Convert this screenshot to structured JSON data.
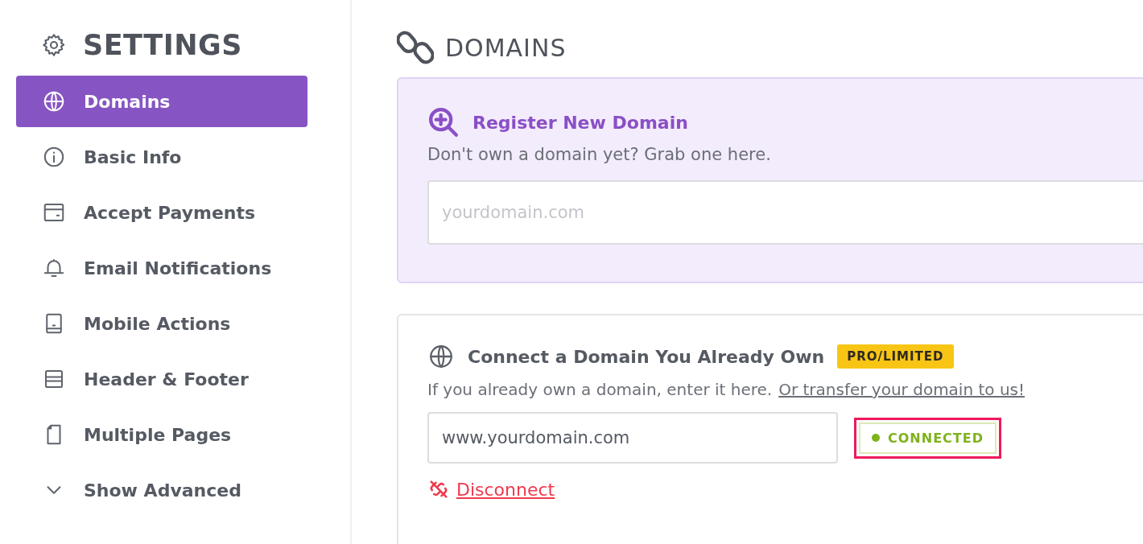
{
  "sidebar": {
    "title": "SETTINGS",
    "items": [
      {
        "label": "Domains",
        "selected": true
      },
      {
        "label": "Basic Info",
        "selected": false
      },
      {
        "label": "Accept Payments",
        "selected": false
      },
      {
        "label": "Email Notifications",
        "selected": false
      },
      {
        "label": "Mobile Actions",
        "selected": false
      },
      {
        "label": "Header & Footer",
        "selected": false
      },
      {
        "label": "Multiple Pages",
        "selected": false
      },
      {
        "label": "Show Advanced",
        "selected": false
      }
    ]
  },
  "main": {
    "title": "DOMAINS",
    "register": {
      "title": "Register New Domain",
      "description": "Don't own a domain yet? Grab one here.",
      "placeholder": "yourdomain.com"
    },
    "connect": {
      "title": "Connect a Domain You Already Own",
      "badge": "PRO/LIMITED",
      "description": "If you already own a domain, enter it here.",
      "link": "Or transfer your domain to us!",
      "value": "www.yourdomain.com",
      "status": {
        "label": "CONNECTED",
        "connected": true,
        "highlighted": true
      },
      "action": "Disconnect"
    }
  }
}
